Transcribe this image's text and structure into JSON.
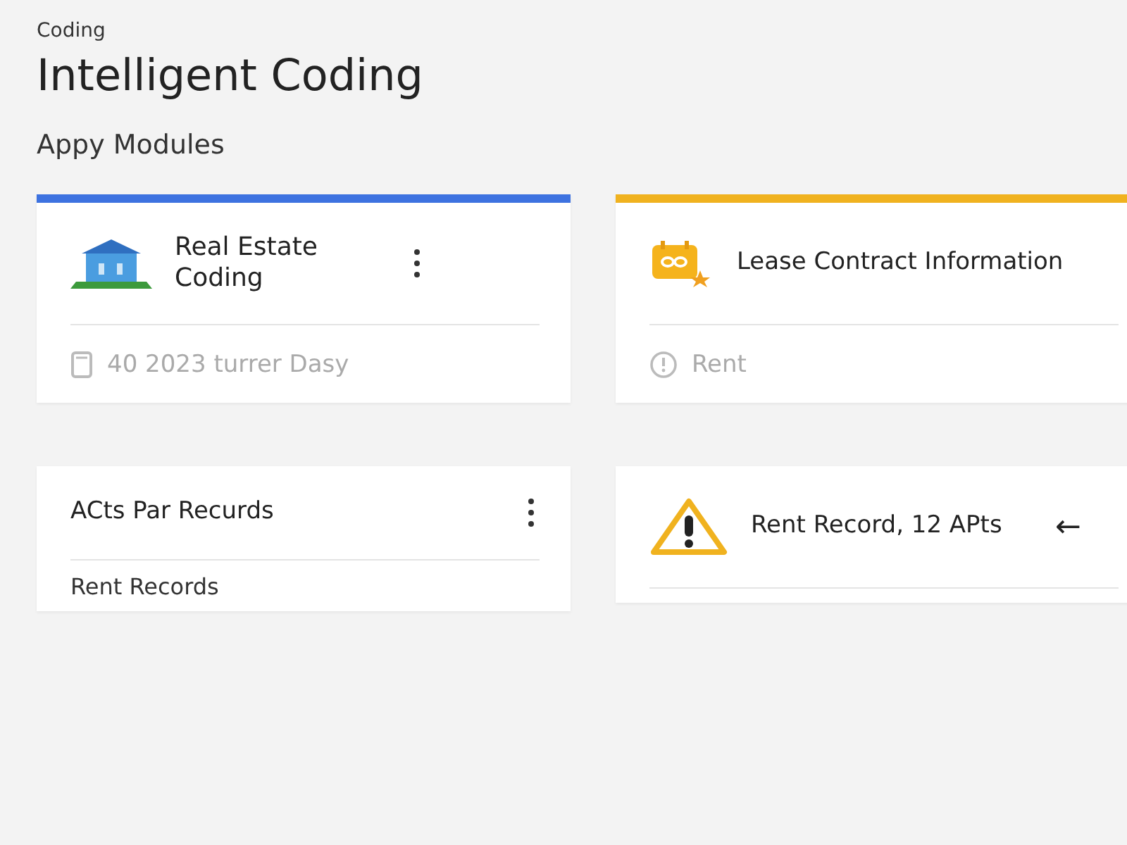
{
  "breadcrumb": "Coding",
  "title": "Intelligent Coding",
  "section": "Appy Modules",
  "cards": [
    {
      "kind": "property",
      "color": "#3d72e0",
      "title": "Real Estate Coding",
      "menu": true,
      "footer": {
        "kind": "document",
        "text": "40 2023 turrer Dasy",
        "muted": true
      }
    },
    {
      "kind": "contract",
      "color": "#f0b21f",
      "title": "Lease Contract Information",
      "menu": false,
      "footer": {
        "kind": "info",
        "text": "Rent",
        "muted": true
      }
    },
    {
      "kind": "plain",
      "title": "ACts Par Recurds",
      "menu": true,
      "footer": {
        "kind": "none",
        "text": "Rent Records",
        "muted": false
      }
    },
    {
      "kind": "warning",
      "title": "Rent Record, 12 APts",
      "menu": false,
      "action": "←"
    }
  ]
}
